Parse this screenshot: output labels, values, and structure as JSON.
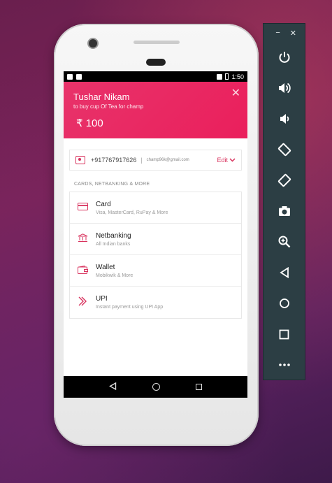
{
  "status_bar": {
    "time": "1:50"
  },
  "payment": {
    "customer_name": "Tushar Nikam",
    "description": "to buy cup Of Tea for champ",
    "amount": "₹ 100",
    "close_label": "✕"
  },
  "contact": {
    "phone": "+917767917626",
    "separator": "|",
    "email": "champ96k@gmail.com",
    "edit_label": "Edit"
  },
  "methods_section_label": "CARDS, NETBANKING & MORE",
  "methods": [
    {
      "title": "Card",
      "subtitle": "Visa, MasterCard, RuPay & More",
      "icon": "credit-card-icon"
    },
    {
      "title": "Netbanking",
      "subtitle": "All Indian banks",
      "icon": "bank-icon"
    },
    {
      "title": "Wallet",
      "subtitle": "Mobikwik & More",
      "icon": "wallet-icon"
    },
    {
      "title": "UPI",
      "subtitle": "Instant payment using UPI App",
      "icon": "upi-icon"
    }
  ],
  "emulator_toolbar": {
    "minimize": "−",
    "close": "✕",
    "buttons": [
      "power-icon",
      "volume-up-icon",
      "volume-down-icon",
      "rotate-left-icon",
      "rotate-right-icon",
      "camera-icon",
      "zoom-icon",
      "back-icon",
      "home-icon",
      "overview-icon",
      "more-icon"
    ]
  },
  "colors": {
    "accent": "#ea1f5c",
    "emulator_panel": "#2c3e44"
  }
}
